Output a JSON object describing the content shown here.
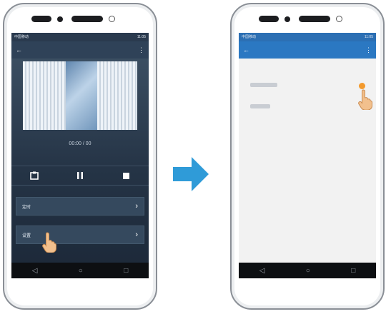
{
  "left_phone": {
    "status_left": "中国移动",
    "status_right": "11:05",
    "title": "",
    "menu_item_1": "定时",
    "menu_item_2": "设置",
    "timer_text": "00:00 / 00",
    "chevron": "›"
  },
  "right_phone": {
    "status_left": "中国移动",
    "status_right": "11:05",
    "title": "",
    "setting_row_1": "",
    "setting_row_2": ""
  },
  "colors": {
    "transition_arrow": "#2f9bd8",
    "toggle_accent": "#f39a2d"
  },
  "icons": [
    "back-arrow-icon",
    "more-icon",
    "record-icon",
    "pause-icon",
    "stop-icon",
    "chevron-right-icon",
    "nav-back-icon",
    "nav-home-icon",
    "nav-recent-icon",
    "pointing-hand-icon",
    "transition-arrow-icon"
  ]
}
